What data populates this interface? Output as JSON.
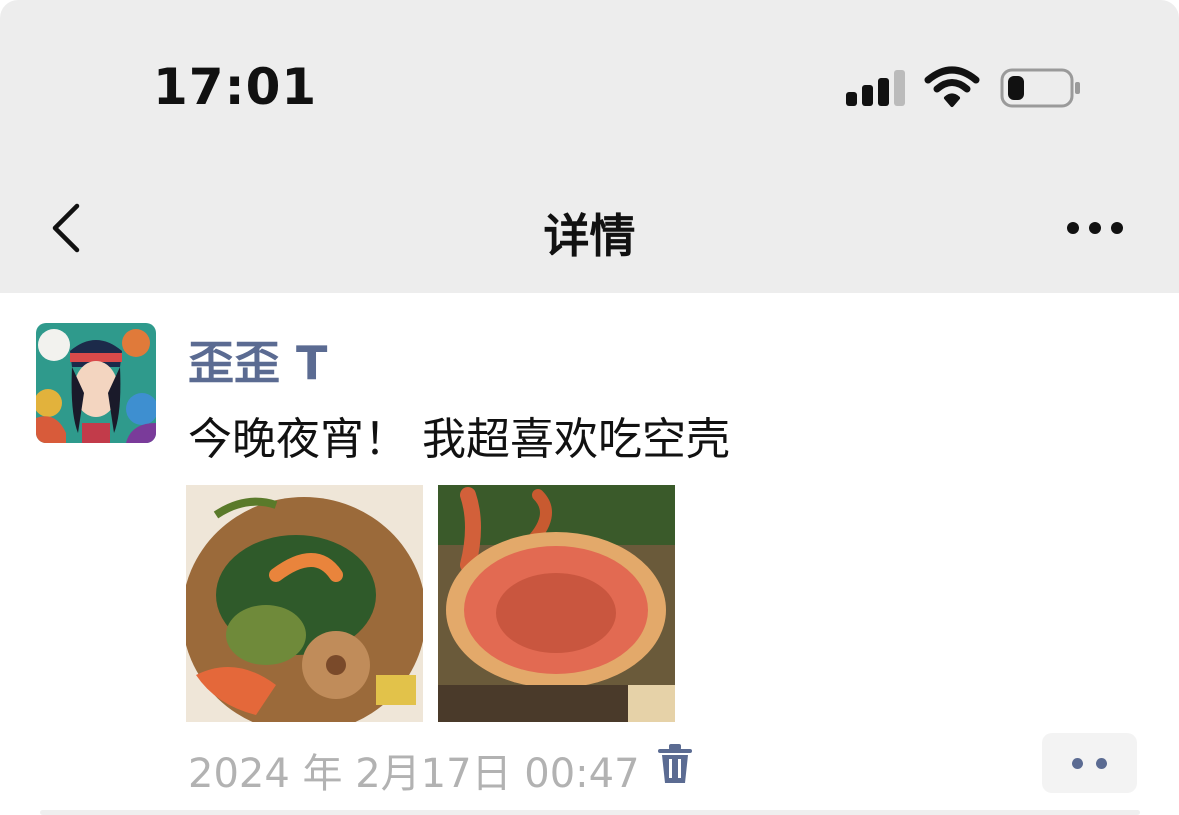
{
  "status_bar": {
    "time": "17:01",
    "icons": [
      "cellular-signal-icon",
      "wifi-icon",
      "battery-icon"
    ],
    "battery_level": 0.2
  },
  "nav": {
    "title": "详情",
    "back_icon": "chevron-left-icon",
    "more_icon": "more-dots-icon"
  },
  "post": {
    "username": "歪歪 T",
    "text": "今晚夜宵！ 我超喜欢吃空壳",
    "photos": [
      "crab-stirfry-photo",
      "crab-shell-photo"
    ],
    "timestamp": "2024 年 2月17日 00:47",
    "delete_icon": "trash-icon",
    "action_icon": "two-dots-icon"
  },
  "colors": {
    "bar_background": "#ededed",
    "username_color": "#5b6b92",
    "timestamp_color": "#b2b2b2",
    "text_color": "#111111"
  }
}
